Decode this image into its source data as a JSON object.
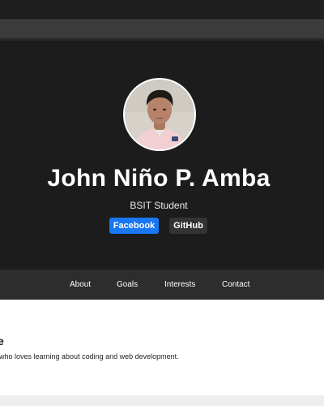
{
  "profile": {
    "name": "John Niño P. Amba",
    "role": "BSIT Student",
    "avatar_icon": "portrait-photo"
  },
  "social": {
    "facebook_label": "Facebook",
    "github_label": "GitHub",
    "facebook_color": "#1877f2",
    "github_color": "#333333"
  },
  "nav": {
    "items": [
      {
        "label": "About"
      },
      {
        "label": "Goals"
      },
      {
        "label": "Interests"
      },
      {
        "label": "Contact"
      }
    ]
  },
  "about": {
    "heading": "e",
    "text": "who loves learning about coding and web development."
  },
  "colors": {
    "hero_background": "#1c1c1c",
    "nav_background": "#2d2d2d",
    "content_background": "#ffffff"
  }
}
